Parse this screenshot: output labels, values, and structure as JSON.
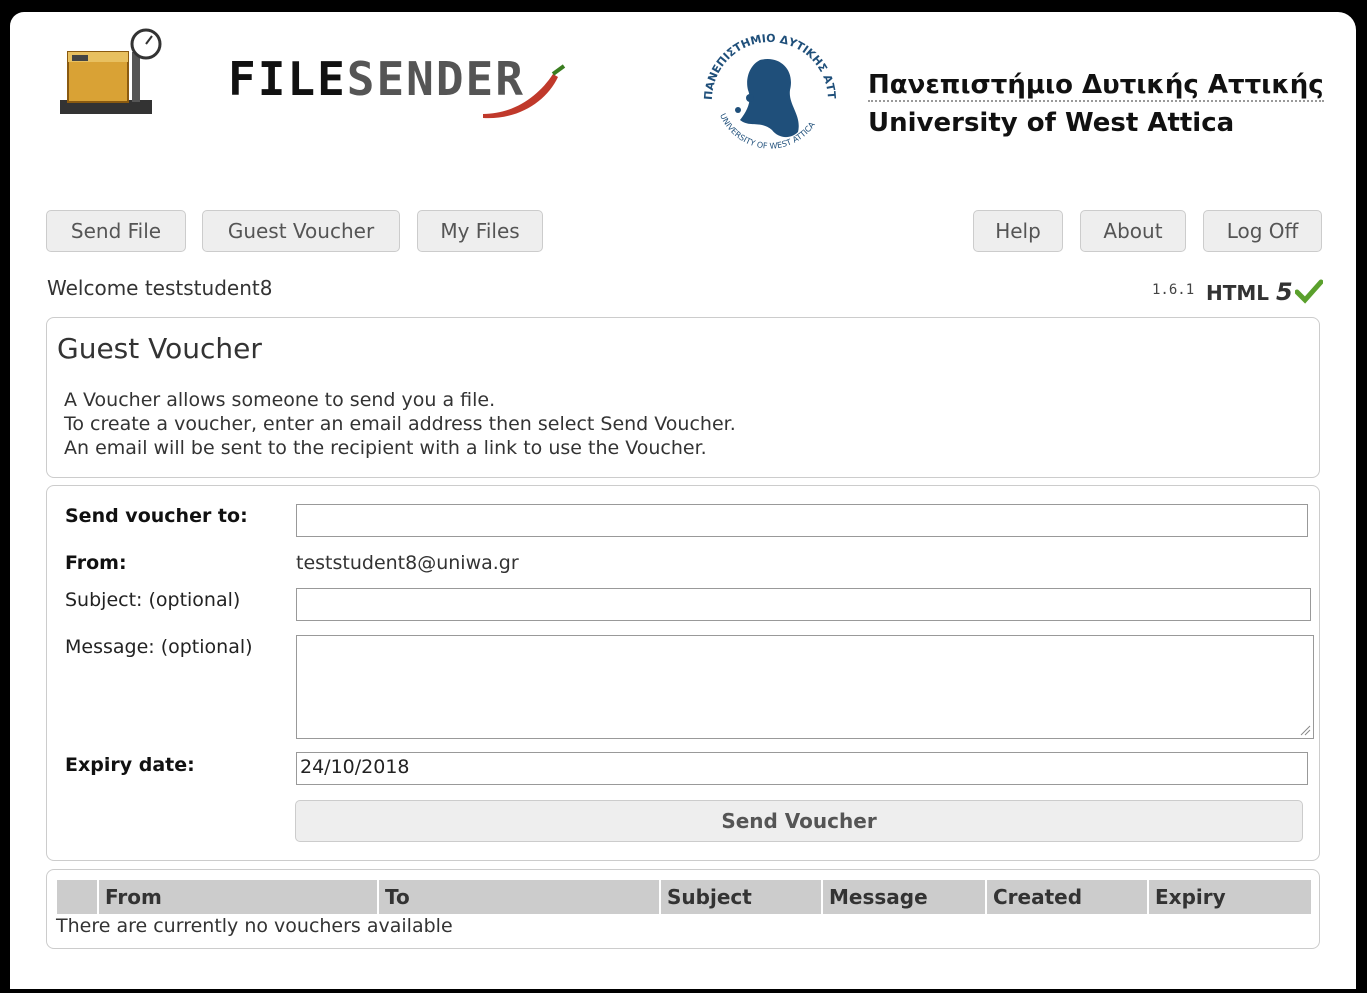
{
  "header": {
    "app_logo_text_part1": "FILE",
    "app_logo_text_part2": "SENDER",
    "university_name_greek": "Πανεπιστήμιο Δυτικής Αττικής",
    "university_name_english": "University of West Attica",
    "seal_text_top": "ΠΑΝΕΠΙΣΤΗΜΙΟ ΔΥΤΙΚΗΣ ΑΤΤΙΚΗΣ",
    "seal_text_bottom": "UNIVERSITY OF WEST ATTICA"
  },
  "nav": {
    "send_file": "Send File",
    "guest_voucher": "Guest Voucher",
    "my_files": "My Files",
    "help": "Help",
    "about": "About",
    "log_off": "Log Off"
  },
  "status": {
    "welcome": "Welcome teststudent8",
    "version": "1.6.1",
    "html_label": "HTML",
    "html_five": "5"
  },
  "intro": {
    "title": "Guest Voucher",
    "line1": "A Voucher allows someone to send you a file.",
    "line2": "To create a voucher, enter an email address then select Send Voucher.",
    "line3": "An email will be sent to the recipient with a link to use the Voucher."
  },
  "form": {
    "send_to_label": "Send voucher to:",
    "send_to_value": "",
    "from_label": "From:",
    "from_value": "teststudent8@uniwa.gr",
    "subject_label": "Subject: (optional)",
    "subject_value": "",
    "message_label": "Message: (optional)",
    "message_value": "",
    "expiry_label": "Expiry date:",
    "expiry_value": "24/10/2018",
    "send_button": "Send Voucher"
  },
  "vouchers_table": {
    "columns": [
      "From",
      "To",
      "Subject",
      "Message",
      "Created",
      "Expiry"
    ],
    "empty_message": "There are currently no vouchers available"
  },
  "colors": {
    "button_bg": "#eeeeee",
    "table_header_bg": "#cccccc",
    "check_green": "#5aa02c",
    "seal_blue": "#1f4f7a",
    "pepper_red": "#c0392b"
  }
}
